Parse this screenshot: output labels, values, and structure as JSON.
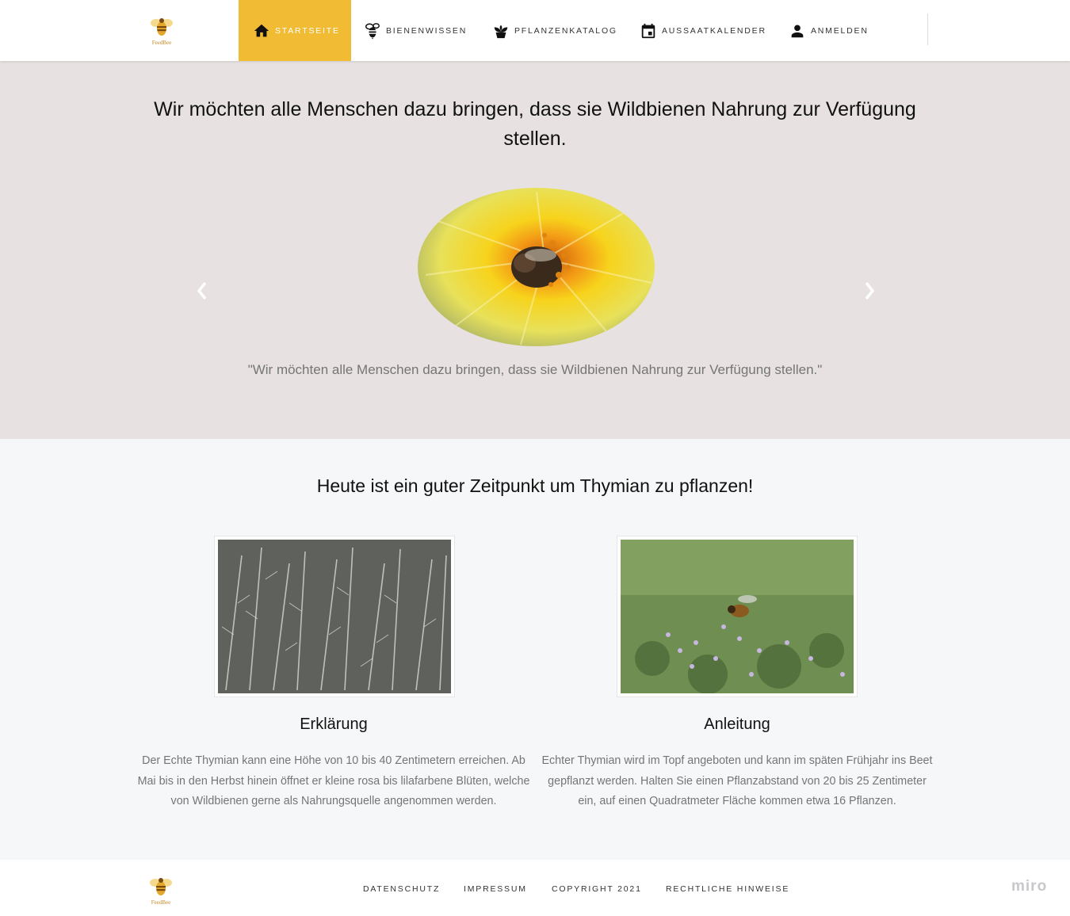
{
  "brand": {
    "name": "FeedBee"
  },
  "nav": {
    "items": [
      {
        "label": "STARTSEITE",
        "icon": "home-icon",
        "active": true
      },
      {
        "label": "BIENENWISSEN",
        "icon": "bee-icon",
        "active": false
      },
      {
        "label": "PFLANZENKATALOG",
        "icon": "potted-plant-icon",
        "active": false
      },
      {
        "label": "AUSSAATKALENDER",
        "icon": "calendar-icon",
        "active": false
      },
      {
        "label": "ANMELDEN",
        "icon": "user-icon",
        "active": false
      }
    ]
  },
  "hero": {
    "title": "Wir möchten alle Menschen dazu bringen, dass sie Wildbienen Nahrung zur Verfügung stellen.",
    "caption": "\"Wir möchten alle Menschen dazu bringen, dass sie Wildbienen Nahrung zur Verfügung stellen.\"",
    "prev_icon": "chevron-left-icon",
    "next_icon": "chevron-right-icon"
  },
  "plant": {
    "headline": "Heute ist ein guter Zeitpunkt um Thymian zu pflanzen!",
    "cards": [
      {
        "title": "Erklärung",
        "text": "Der Echte Thymian kann eine Höhe von 10 bis 40 Zentimetern erreichen. Ab Mai bis in den Herbst hinein öffnet er kleine rosa bis lilafarbene Blüten, welche von Wildbienen gerne als Nahrungsquelle angenommen werden."
      },
      {
        "title": "Anleitung",
        "text": "Echter Thymian wird im Topf angeboten und kann im späten Frühjahr ins Beet gepflanzt werden. Halten Sie einen Pflanzabstand von 20 bis 25 Zentimeter ein, auf einen Quadratmeter Fläche kommen etwa 16 Pflanzen."
      }
    ]
  },
  "footer": {
    "links": [
      "DATENSCHUTZ",
      "IMPRESSUM",
      "COPYRIGHT 2021",
      "RECHTLICHE HINWEISE"
    ],
    "watermark": "miro"
  },
  "colors": {
    "accent": "#f1bc34",
    "hero_bg": "#e7e2e1",
    "section_bg": "#f6f7f8",
    "muted_text": "#757575"
  }
}
